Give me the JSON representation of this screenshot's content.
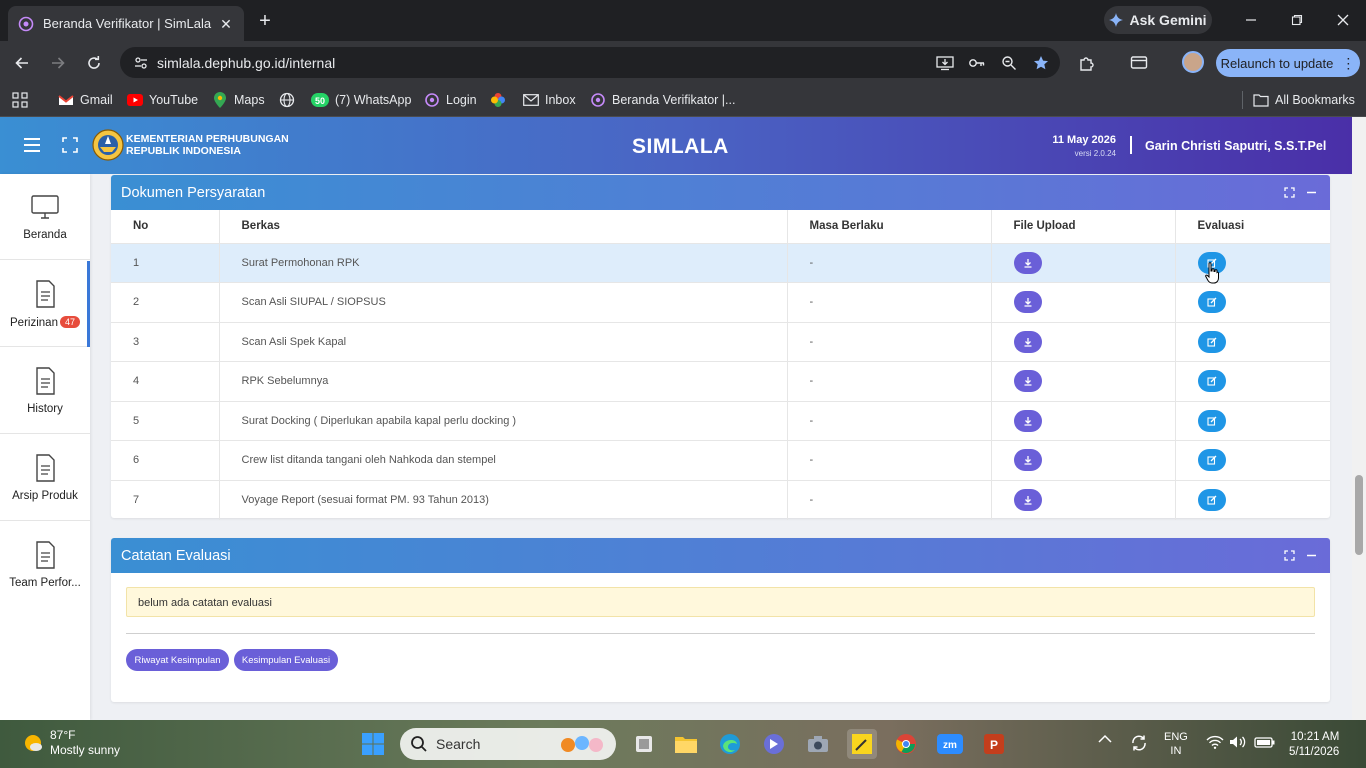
{
  "browser": {
    "tab_title": "Beranda Verifikator | SimLala",
    "ask_gemini": "Ask Gemini",
    "url": "simlala.dephub.go.id/internal",
    "relaunch": "Relaunch to update",
    "bookmarks": [
      {
        "label": "Gmail",
        "icon": "gmail-icon"
      },
      {
        "label": "YouTube",
        "icon": "youtube-icon"
      },
      {
        "label": "Maps",
        "icon": "maps-icon"
      },
      {
        "label": "(7) WhatsApp",
        "icon": "whatsapp-icon"
      },
      {
        "label": "Login",
        "icon": "site-icon"
      },
      {
        "label": "Inbox",
        "icon": "mail-icon"
      },
      {
        "label": "Beranda Verifikator |...",
        "icon": "site-icon"
      }
    ],
    "whatsapp_badge": "50",
    "all_bookmarks": "All Bookmarks"
  },
  "header": {
    "ministry_line1": "KEMENTERIAN PERHUBUNGAN",
    "ministry_line2": "REPUBLIK INDONESIA",
    "app_title": "SIMLALA",
    "date": "11 May 2026",
    "version": "versi 2.0.24",
    "user": "Garin Christi Saputri, S.S.T.Pel"
  },
  "sidebar": {
    "items": [
      {
        "label": "Beranda",
        "icon": "monitor-icon"
      },
      {
        "label": "Perizinan",
        "icon": "document-icon",
        "badge": "47"
      },
      {
        "label": "History",
        "icon": "document-icon"
      },
      {
        "label": "Arsip Produk",
        "icon": "document-icon"
      },
      {
        "label": "Team Perfor...",
        "icon": "document-icon"
      }
    ]
  },
  "dokumen": {
    "title": "Dokumen Persyaratan",
    "columns": [
      "No",
      "Berkas",
      "Masa Berlaku",
      "File Upload",
      "Evaluasi"
    ],
    "rows": [
      {
        "no": "1",
        "berkas": "Surat Permohonan RPK",
        "masa": "-"
      },
      {
        "no": "2",
        "berkas": "Scan Asli SIUPAL / SIOPSUS",
        "masa": "-"
      },
      {
        "no": "3",
        "berkas": "Scan Asli Spek Kapal",
        "masa": "-"
      },
      {
        "no": "4",
        "berkas": "RPK Sebelumnya",
        "masa": "-"
      },
      {
        "no": "5",
        "berkas": "Surat Docking ( Diperlukan apabila kapal perlu docking )",
        "masa": "-"
      },
      {
        "no": "6",
        "berkas": "Crew list ditanda tangani oleh Nahkoda dan stempel",
        "masa": "-"
      },
      {
        "no": "7",
        "berkas": "Voyage Report (sesuai format PM. 93 Tahun 2013)",
        "masa": "-"
      }
    ]
  },
  "catatan": {
    "title": "Catatan Evaluasi",
    "note": "belum ada catatan evaluasi",
    "btn_riwayat": "Riwayat Kesimpulan",
    "btn_kesimpulan": "Kesimpulan Evaluasi"
  },
  "taskbar": {
    "temp": "87°F",
    "condition": "Mostly sunny",
    "search": "Search",
    "lang1": "ENG",
    "lang2": "IN",
    "time": "10:21 AM",
    "date": "5/11/2026"
  },
  "colors": {
    "accent": "#3a8fd3",
    "download_button": "#6a5fd8",
    "evaluasi_button": "#1f96e6",
    "badge": "#e74c3c"
  }
}
